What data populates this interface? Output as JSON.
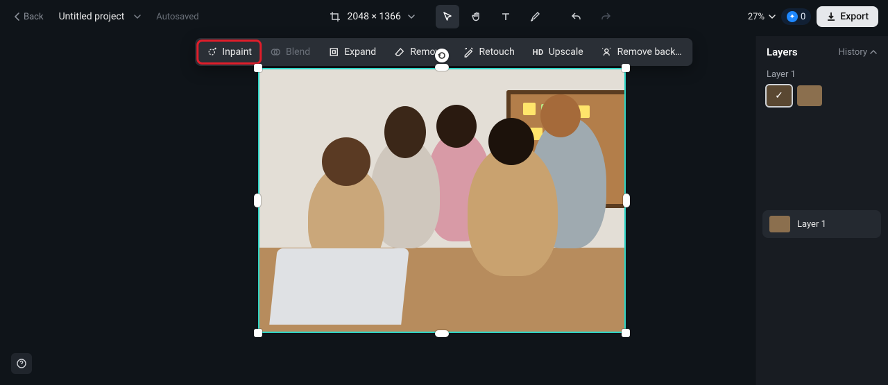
{
  "header": {
    "back": "Back",
    "project_name": "Untitled project",
    "autosave": "Autosaved",
    "dimensions": "2048 × 1366",
    "zoom": "27%",
    "credits": "0",
    "export": "Export"
  },
  "context_toolbar": {
    "inpaint": "Inpaint",
    "blend": "Blend",
    "expand": "Expand",
    "remove": "Remove",
    "retouch": "Retouch",
    "upscale": "Upscale",
    "remove_bg": "Remove back…"
  },
  "panel": {
    "layers_tab": "Layers",
    "history_tab": "History",
    "layer_group_name": "Layer 1",
    "layer_row_label": "Layer 1"
  },
  "icons": {
    "hd": "HD"
  }
}
